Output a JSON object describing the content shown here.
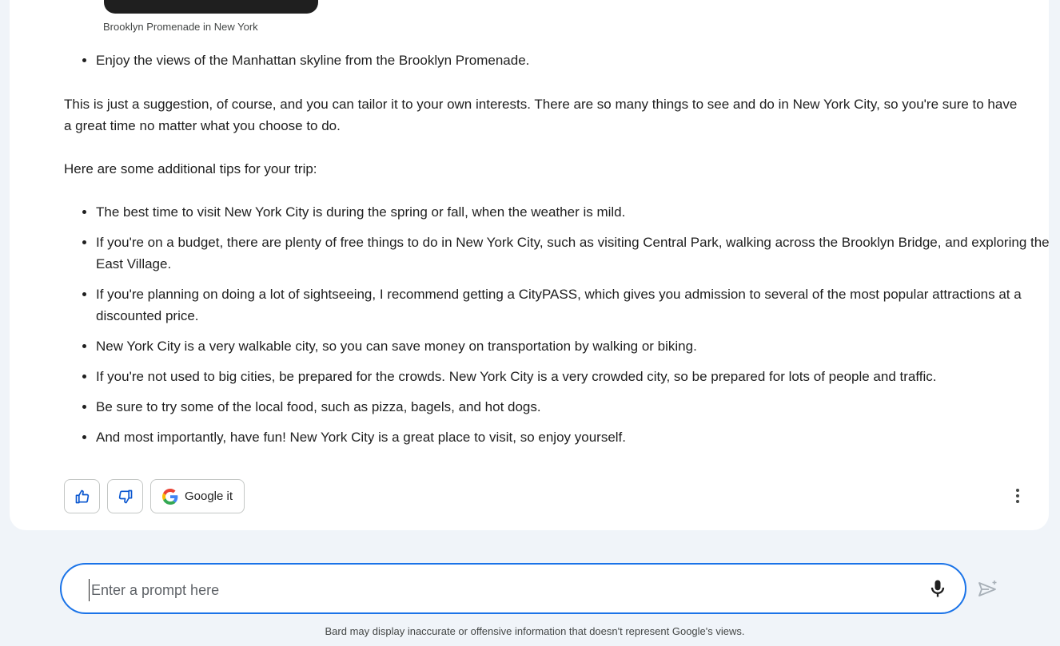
{
  "response": {
    "image_caption": "Brooklyn Promenade in New York",
    "first_bullets": [
      "Enjoy the views of the Manhattan skyline from the Brooklyn Promenade."
    ],
    "paragraph1": "This is just a suggestion, of course, and you can tailor it to your own interests. There are so many things to see and do in New York City, so you're sure to have a great time no matter what you choose to do.",
    "paragraph2": "Here are some additional tips for your trip:",
    "tips": [
      "The best time to visit New York City is during the spring or fall, when the weather is mild.",
      "If you're on a budget, there are plenty of free things to do in New York City, such as visiting Central Park, walking across the Brooklyn Bridge, and exploring the East Village.",
      "If you're planning on doing a lot of sightseeing, I recommend getting a CityPASS, which gives you admission to several of the most popular attractions at a discounted price.",
      "New York City is a very walkable city, so you can save money on transportation by walking or biking.",
      "If you're not used to big cities, be prepared for the crowds. New York City is a very crowded city, so be prepared for lots of people and traffic.",
      "Be sure to try some of the local food, such as pizza, bagels, and hot dogs.",
      "And most importantly, have fun! New York City is a great place to visit, so enjoy yourself."
    ]
  },
  "actions": {
    "thumbs_up_icon": "thumbs-up-icon",
    "thumbs_down_icon": "thumbs-down-icon",
    "google_it_label": "Google it",
    "more_icon": "more-vert-icon"
  },
  "input": {
    "placeholder": "Enter a prompt here",
    "value": "",
    "mic_icon": "microphone-icon",
    "send_icon": "send-icon"
  },
  "footer": {
    "disclaimer": "Bard may display inaccurate or offensive information that doesn't represent Google's views."
  },
  "colors": {
    "background": "#f0f4f9",
    "card": "#ffffff",
    "accent": "#1a73e8",
    "text": "#1f1f1f",
    "muted": "#444746"
  }
}
